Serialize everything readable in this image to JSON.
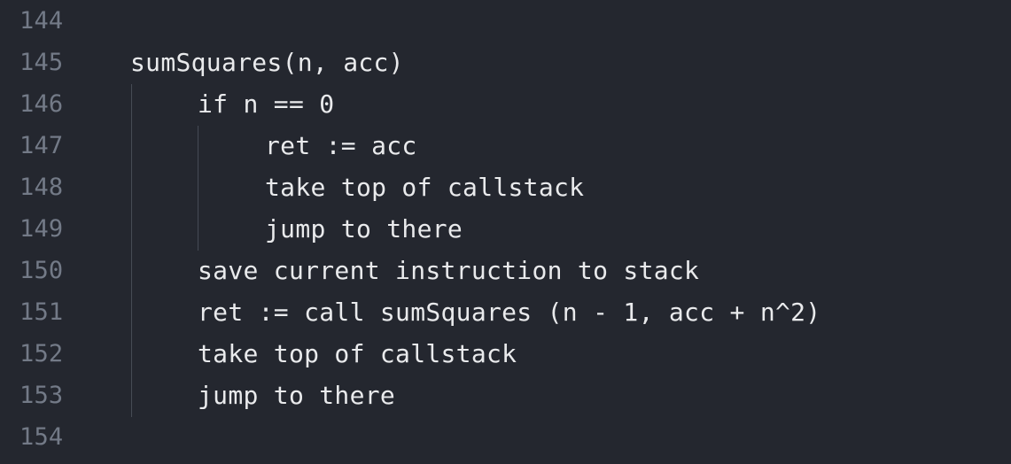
{
  "editor": {
    "lines": [
      {
        "number": "144",
        "text": ""
      },
      {
        "number": "145",
        "text": "sumSquares(n, acc)"
      },
      {
        "number": "146",
        "text": "if n == 0"
      },
      {
        "number": "147",
        "text": "ret := acc"
      },
      {
        "number": "148",
        "text": "take top of callstack"
      },
      {
        "number": "149",
        "text": "jump to there"
      },
      {
        "number": "150",
        "text": "save current instruction to stack"
      },
      {
        "number": "151",
        "text": "ret := call sumSquares (n - 1, acc + n^2)"
      },
      {
        "number": "152",
        "text": "take top of callstack"
      },
      {
        "number": "153",
        "text": "jump to there"
      },
      {
        "number": "154",
        "text": ""
      }
    ]
  }
}
